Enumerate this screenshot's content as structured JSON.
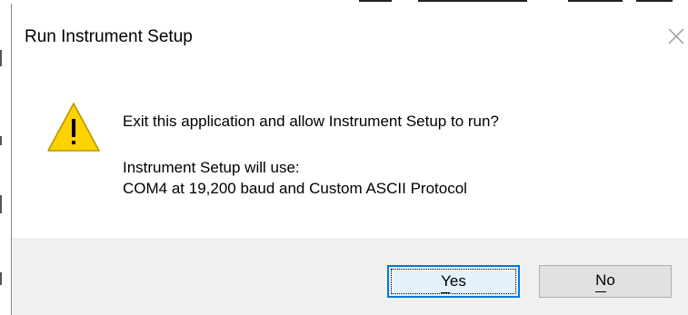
{
  "dialog": {
    "title": "Run Instrument Setup",
    "close_icon": "close-icon",
    "warning_icon": "warning-icon",
    "question": "Exit this application and allow Instrument Setup to run?",
    "uses_label": "Instrument Setup will use:",
    "config_text": "COM4 at 19,200 baud and Custom ASCII Protocol"
  },
  "buttons": {
    "yes_label": "Yes",
    "no_label": "No",
    "yes_mnemonic": "Y",
    "no_mnemonic": "N"
  },
  "colors": {
    "warning_fill": "#FFD200",
    "warning_border": "#B89600",
    "focus_border": "#0078D7",
    "footer_bg": "#F0F0F0"
  }
}
